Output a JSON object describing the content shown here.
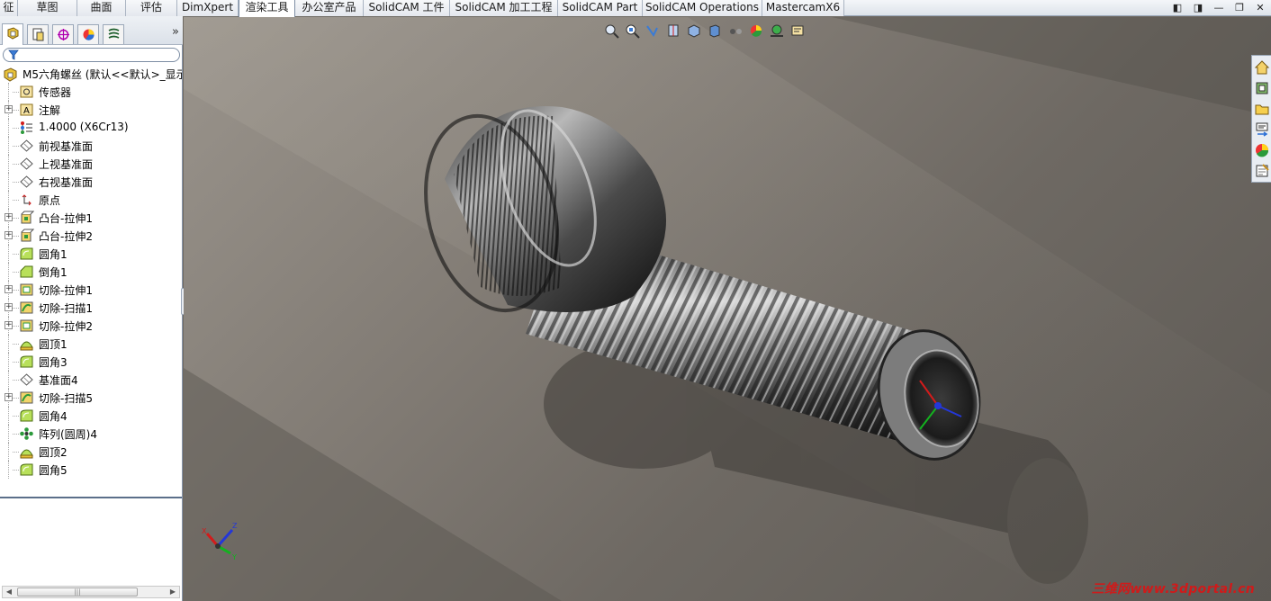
{
  "tabs": [
    {
      "label": "征"
    },
    {
      "label": "草图"
    },
    {
      "label": "曲面"
    },
    {
      "label": "评估"
    },
    {
      "label": "DimXpert"
    },
    {
      "label": "渲染工具"
    },
    {
      "label": "办公室产品"
    },
    {
      "label": "SolidCAM 工件"
    },
    {
      "label": "SolidCAM 加工工程"
    },
    {
      "label": "SolidCAM Part"
    },
    {
      "label": "SolidCAM Operations"
    },
    {
      "label": "MastercamX6"
    }
  ],
  "active_tab": "渲染工具",
  "feature_tree": {
    "root_label": "M5六角螺丝 (默认<<默认>_显示",
    "items": [
      {
        "label": "传感器",
        "icon": "sensor-icon",
        "expandable": false
      },
      {
        "label": "注解",
        "icon": "annotation-icon",
        "expandable": true
      },
      {
        "label": "1.4000 (X6Cr13)",
        "icon": "material-icon",
        "expandable": false
      },
      {
        "label": "前视基准面",
        "icon": "plane-icon",
        "expandable": false
      },
      {
        "label": "上视基准面",
        "icon": "plane-icon",
        "expandable": false
      },
      {
        "label": "右视基准面",
        "icon": "plane-icon",
        "expandable": false
      },
      {
        "label": "原点",
        "icon": "origin-icon",
        "expandable": false
      },
      {
        "label": "凸台-拉伸1",
        "icon": "extrude-icon",
        "expandable": true
      },
      {
        "label": "凸台-拉伸2",
        "icon": "extrude-icon",
        "expandable": true
      },
      {
        "label": "圆角1",
        "icon": "fillet-icon",
        "expandable": false
      },
      {
        "label": "倒角1",
        "icon": "chamfer-icon",
        "expandable": false
      },
      {
        "label": "切除-拉伸1",
        "icon": "cut-extrude-icon",
        "expandable": true
      },
      {
        "label": "切除-扫描1",
        "icon": "cut-sweep-icon",
        "expandable": true
      },
      {
        "label": "切除-拉伸2",
        "icon": "cut-extrude-icon",
        "expandable": true
      },
      {
        "label": "圆顶1",
        "icon": "dome-icon",
        "expandable": false
      },
      {
        "label": "圆角3",
        "icon": "fillet-icon",
        "expandable": false
      },
      {
        "label": "基准面4",
        "icon": "plane-icon",
        "expandable": false
      },
      {
        "label": "切除-扫描5",
        "icon": "cut-sweep-icon",
        "expandable": true
      },
      {
        "label": "圆角4",
        "icon": "fillet-icon",
        "expandable": false
      },
      {
        "label": "阵列(圆周)4",
        "icon": "circular-pattern-icon",
        "expandable": false
      },
      {
        "label": "圆顶2",
        "icon": "dome-icon",
        "expandable": false
      },
      {
        "label": "圆角5",
        "icon": "fillet-icon",
        "expandable": false
      }
    ]
  },
  "panel_tab_icons": [
    "feature-manager-icon",
    "property-manager-icon",
    "configuration-manager-icon",
    "display-manager-icon",
    "dimxpert-manager-icon"
  ],
  "headsup_icons": [
    "zoom-to-fit-icon",
    "zoom-area-icon",
    "previous-view-icon",
    "section-view-icon",
    "view-orientation-icon",
    "display-style-icon",
    "hide-show-icon",
    "edit-appearance-icon",
    "apply-scene-icon",
    "view-settings-icon"
  ],
  "taskpane_icons": [
    "home-icon",
    "design-library-icon",
    "file-explorer-icon",
    "view-palette-icon",
    "appearances-icon",
    "custom-properties-icon"
  ],
  "triad": {
    "x": "X",
    "y": "Y",
    "z": "Z"
  },
  "watermark": "三维网www.3dportal.cn",
  "colors": {
    "accent": "#316ac5",
    "watermark": "#d01a1a"
  }
}
